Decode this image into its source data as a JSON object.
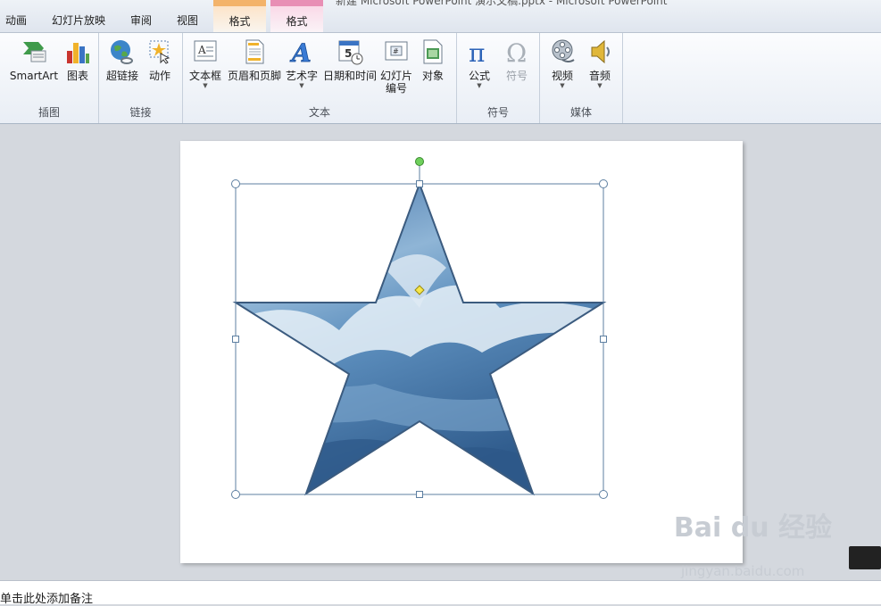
{
  "window": {
    "title": "新建 Microsoft PowerPoint 演示文稿.pptx - Microsoft PowerPoint"
  },
  "tabs": [
    {
      "label": "动画"
    },
    {
      "label": "幻灯片放映"
    },
    {
      "label": "审阅"
    },
    {
      "label": "视图"
    }
  ],
  "context_tabs": [
    {
      "label": "格式",
      "color": "#f3b36a"
    },
    {
      "label": "格式",
      "color": "#e88fb5"
    }
  ],
  "ribbon": {
    "groups": [
      {
        "label": "插图",
        "buttons": [
          {
            "label": "SmartArt",
            "icon": "smartart-icon"
          },
          {
            "label": "图表",
            "icon": "chart-icon"
          }
        ]
      },
      {
        "label": "链接",
        "buttons": [
          {
            "label": "超链接",
            "icon": "hyperlink-icon"
          },
          {
            "label": "动作",
            "icon": "action-icon"
          }
        ]
      },
      {
        "label": "文本",
        "buttons": [
          {
            "label": "文本框",
            "icon": "textbox-icon"
          },
          {
            "label": "页眉和页脚",
            "icon": "header-footer-icon"
          },
          {
            "label": "艺术字",
            "icon": "wordart-icon"
          },
          {
            "label": "日期和时间",
            "icon": "date-time-icon"
          },
          {
            "label": "幻灯片",
            "label2": "编号",
            "icon": "slide-number-icon"
          },
          {
            "label": "对象",
            "icon": "object-icon"
          }
        ]
      },
      {
        "label": "符号",
        "buttons": [
          {
            "label": "公式",
            "icon": "equation-icon"
          },
          {
            "label": "符号",
            "icon": "symbol-icon",
            "disabled": true
          }
        ]
      },
      {
        "label": "媒体",
        "buttons": [
          {
            "label": "视频",
            "icon": "video-icon"
          },
          {
            "label": "音频",
            "icon": "audio-icon"
          }
        ]
      }
    ]
  },
  "notes": {
    "placeholder": "单击此处添加备注"
  },
  "watermark": {
    "main": "Bai du 经验",
    "sub": "jingyan.baidu.com"
  }
}
